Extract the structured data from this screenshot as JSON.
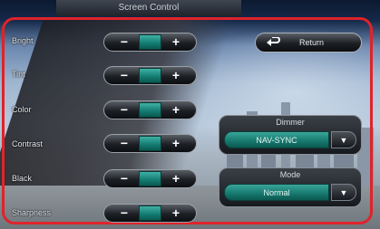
{
  "title": "Screen Control",
  "rows": [
    {
      "label": "Bright"
    },
    {
      "label": "Tint"
    },
    {
      "label": "Color"
    },
    {
      "label": "Contrast"
    },
    {
      "label": "Black"
    },
    {
      "label": "Sharpness"
    }
  ],
  "controls": {
    "minus": "−",
    "plus": "+"
  },
  "return_label": "Return",
  "dimmer": {
    "title": "Dimmer",
    "value": "NAV-SYNC",
    "arrow": "▼"
  },
  "mode": {
    "title": "Mode",
    "value": "Normal",
    "arrow": "▼"
  },
  "colors": {
    "highlight": "#e0232a",
    "accent_teal": "#15776d"
  }
}
